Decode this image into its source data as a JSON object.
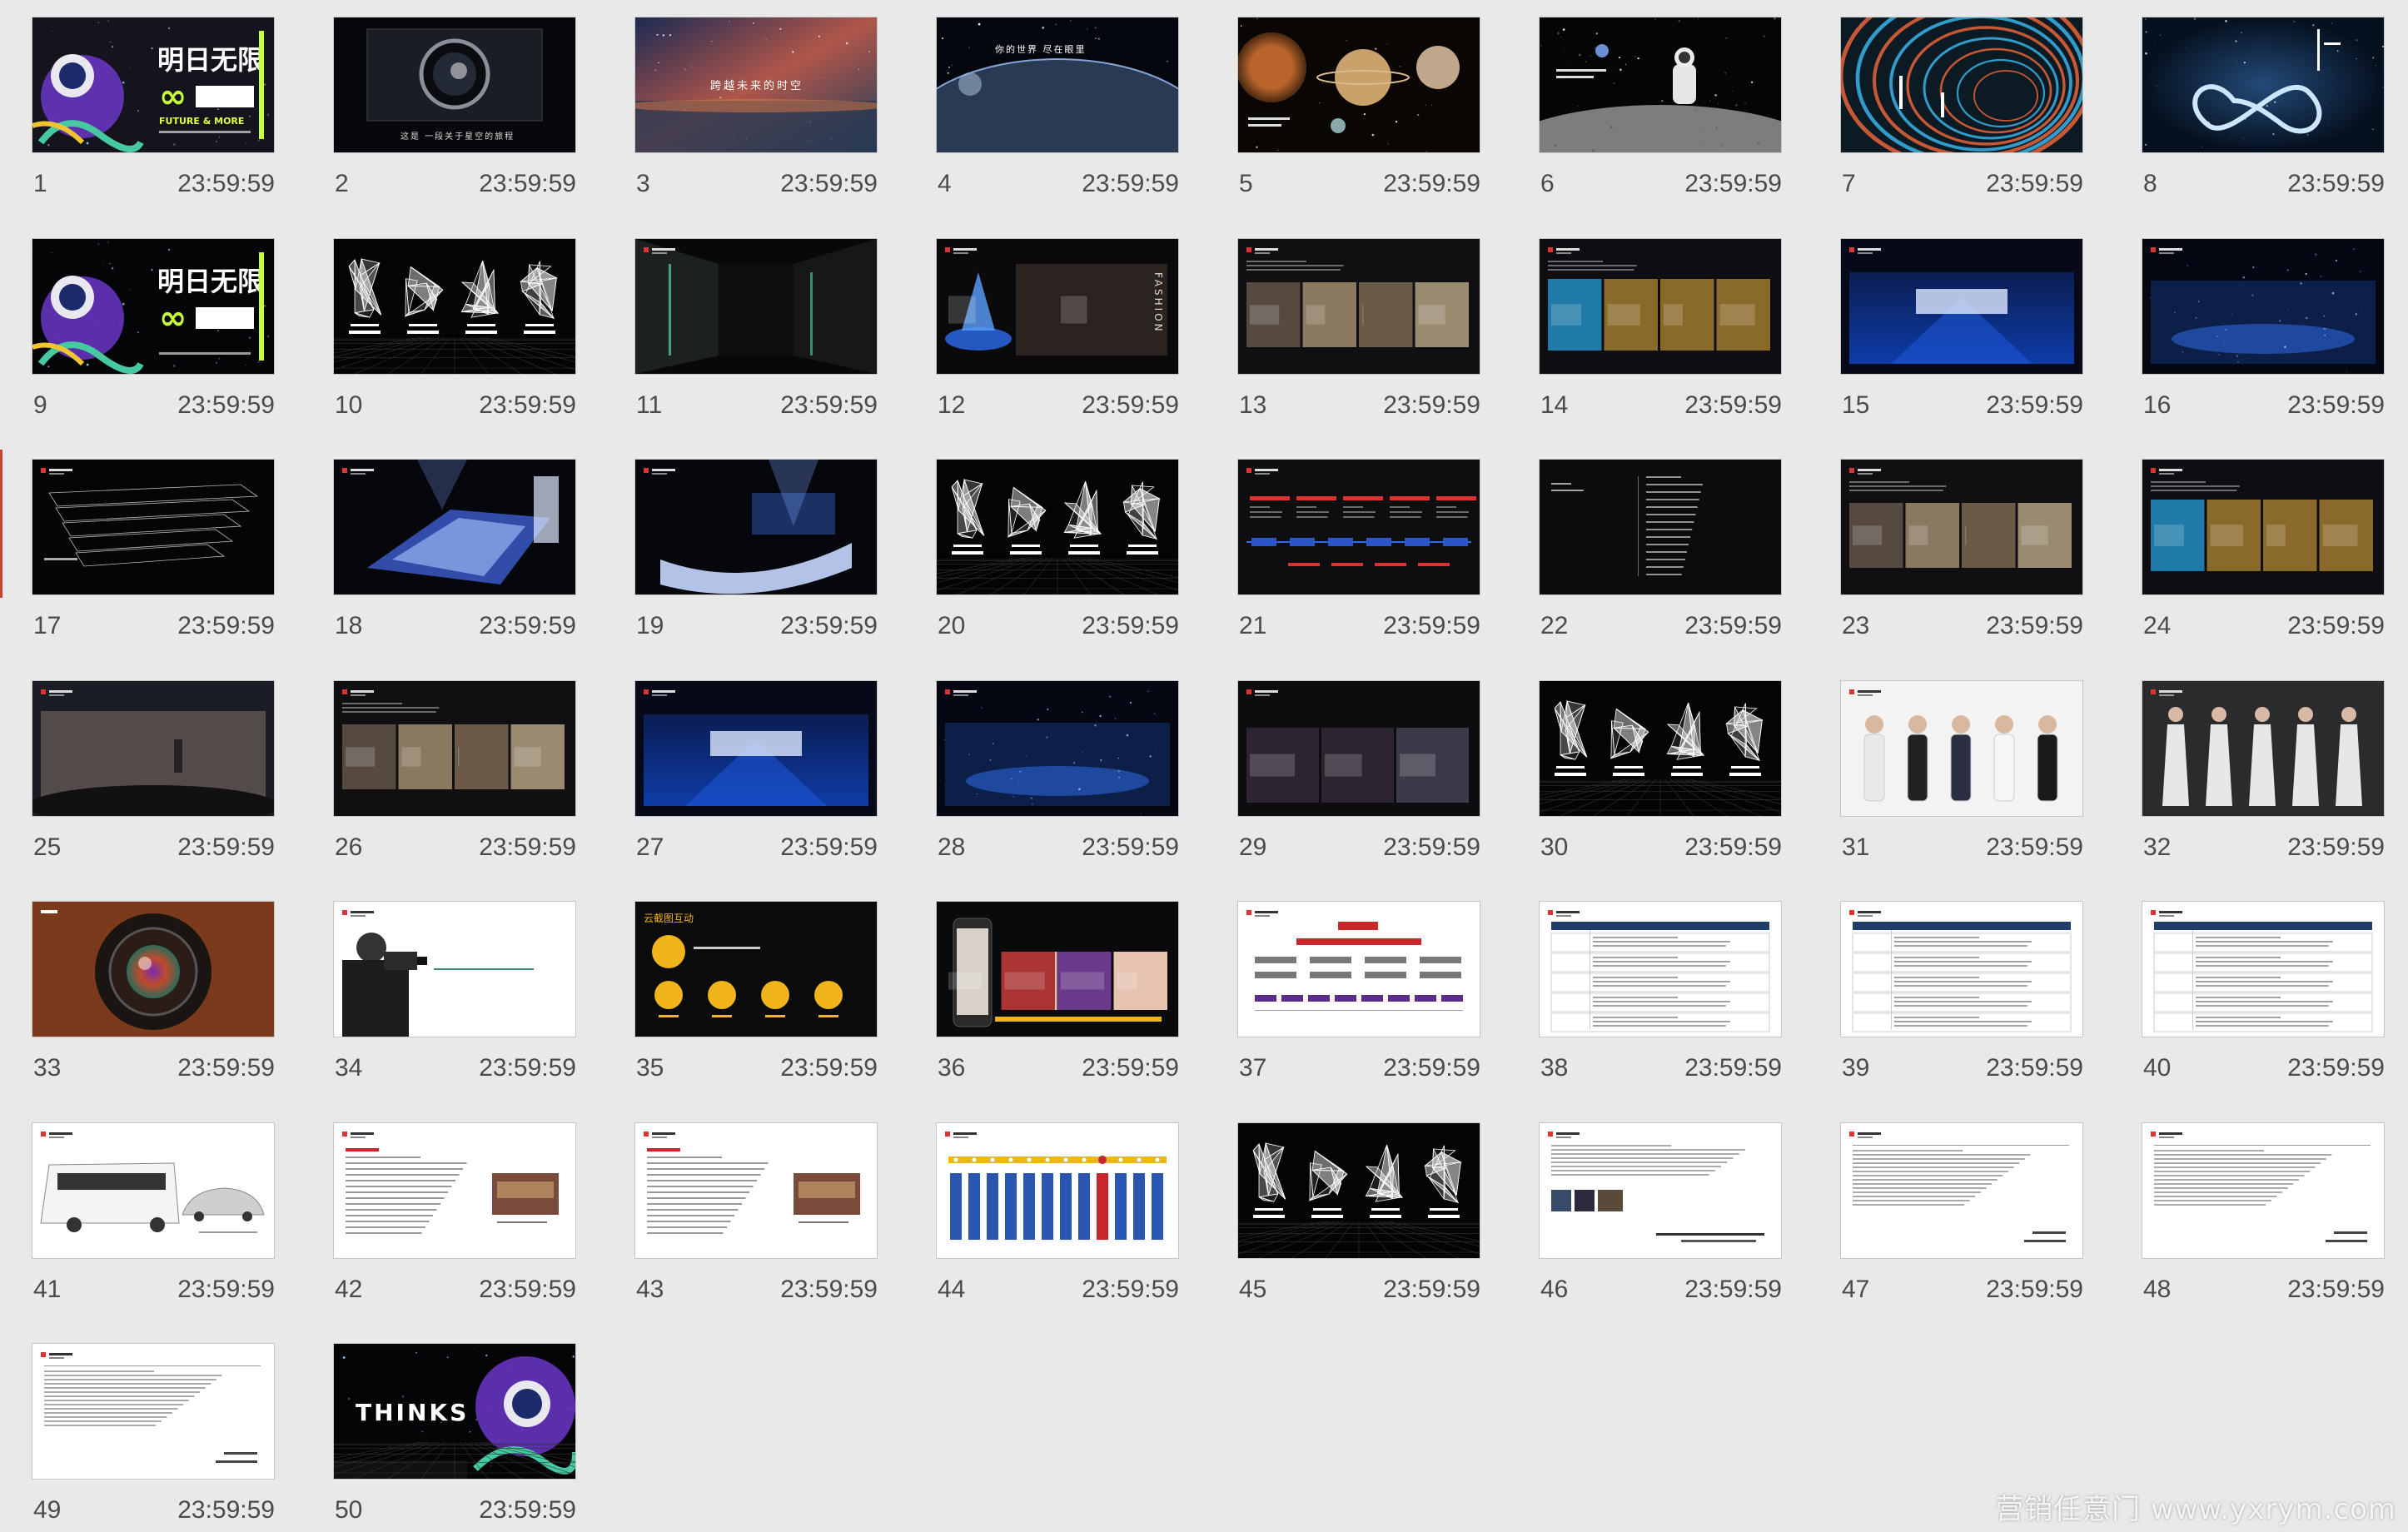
{
  "view": "slide-sorter",
  "selected_slide": 17,
  "colors": {
    "background": "#e9e9e9",
    "label_text": "#4b4b4b",
    "selection_marker": "#c9422f"
  },
  "slides": [
    {
      "number": "1",
      "duration": "23:59:59",
      "style": "cover",
      "title": "明日无限",
      "subtitle": "FUTURE & MORE"
    },
    {
      "number": "2",
      "duration": "23:59:59",
      "style": "space-tunnel",
      "caption": "这是 一段关于星空的旅程"
    },
    {
      "number": "3",
      "duration": "23:59:59",
      "style": "nebula",
      "caption": "跨越未来的时空"
    },
    {
      "number": "4",
      "duration": "23:59:59",
      "style": "planet-rise",
      "caption": "你的世界 尽在眼里"
    },
    {
      "number": "5",
      "duration": "23:59:59",
      "style": "planets"
    },
    {
      "number": "6",
      "duration": "23:59:59",
      "style": "moon-astronaut"
    },
    {
      "number": "7",
      "duration": "23:59:59",
      "style": "tunnel-rings"
    },
    {
      "number": "8",
      "duration": "23:59:59",
      "style": "infinity-blue"
    },
    {
      "number": "9",
      "duration": "23:59:59",
      "style": "cover-dark",
      "title": "明日无限"
    },
    {
      "number": "10",
      "duration": "23:59:59",
      "style": "parts"
    },
    {
      "number": "11",
      "duration": "23:59:59",
      "style": "corridor"
    },
    {
      "number": "12",
      "duration": "23:59:59",
      "style": "entrance",
      "caption": "FASHION"
    },
    {
      "number": "13",
      "duration": "23:59:59",
      "style": "display-photos"
    },
    {
      "number": "14",
      "duration": "23:59:59",
      "style": "display-photos-color"
    },
    {
      "number": "15",
      "duration": "23:59:59",
      "style": "stage-blue"
    },
    {
      "number": "16",
      "duration": "23:59:59",
      "style": "hall-blue"
    },
    {
      "number": "17",
      "duration": "23:59:59",
      "style": "wireframe"
    },
    {
      "number": "18",
      "duration": "23:59:59",
      "style": "stage-render"
    },
    {
      "number": "19",
      "duration": "23:59:59",
      "style": "stage-render-2"
    },
    {
      "number": "20",
      "duration": "23:59:59",
      "style": "parts"
    },
    {
      "number": "21",
      "duration": "23:59:59",
      "style": "timeline-red"
    },
    {
      "number": "22",
      "duration": "23:59:59",
      "style": "text-list"
    },
    {
      "number": "23",
      "duration": "23:59:59",
      "style": "display-photos"
    },
    {
      "number": "24",
      "duration": "23:59:59",
      "style": "display-photos-color"
    },
    {
      "number": "25",
      "duration": "23:59:59",
      "style": "speech-photo"
    },
    {
      "number": "26",
      "duration": "23:59:59",
      "style": "display-photos"
    },
    {
      "number": "27",
      "duration": "23:59:59",
      "style": "stage-blue"
    },
    {
      "number": "28",
      "duration": "23:59:59",
      "style": "hall-blue"
    },
    {
      "number": "29",
      "duration": "23:59:59",
      "style": "group-photos"
    },
    {
      "number": "30",
      "duration": "23:59:59",
      "style": "parts"
    },
    {
      "number": "31",
      "duration": "23:59:59",
      "style": "hosts-light"
    },
    {
      "number": "32",
      "duration": "23:59:59",
      "style": "models-dark"
    },
    {
      "number": "33",
      "duration": "23:59:59",
      "style": "lens"
    },
    {
      "number": "34",
      "duration": "23:59:59",
      "style": "camera-light"
    },
    {
      "number": "35",
      "duration": "23:59:59",
      "style": "yellow-icons",
      "caption": "云截图互动"
    },
    {
      "number": "36",
      "duration": "23:59:59",
      "style": "phone-photos"
    },
    {
      "number": "37",
      "duration": "23:59:59",
      "style": "org-chart"
    },
    {
      "number": "38",
      "duration": "23:59:59",
      "style": "doc-table"
    },
    {
      "number": "39",
      "duration": "23:59:59",
      "style": "doc-table"
    },
    {
      "number": "40",
      "duration": "23:59:59",
      "style": "doc-table"
    },
    {
      "number": "41",
      "duration": "23:59:59",
      "style": "bus"
    },
    {
      "number": "42",
      "duration": "23:59:59",
      "style": "doc-photo"
    },
    {
      "number": "43",
      "duration": "23:59:59",
      "style": "doc-photo"
    },
    {
      "number": "44",
      "duration": "23:59:59",
      "style": "flow-blue"
    },
    {
      "number": "45",
      "duration": "23:59:59",
      "style": "parts"
    },
    {
      "number": "46",
      "duration": "23:59:59",
      "style": "doc-text-photo"
    },
    {
      "number": "47",
      "duration": "23:59:59",
      "style": "doc-text"
    },
    {
      "number": "48",
      "duration": "23:59:59",
      "style": "doc-text"
    },
    {
      "number": "49",
      "duration": "23:59:59",
      "style": "doc-text"
    },
    {
      "number": "50",
      "duration": "23:59:59",
      "style": "thanks",
      "title": "THINKS"
    }
  ],
  "watermark": "营销任意门 www.yxrym.com"
}
